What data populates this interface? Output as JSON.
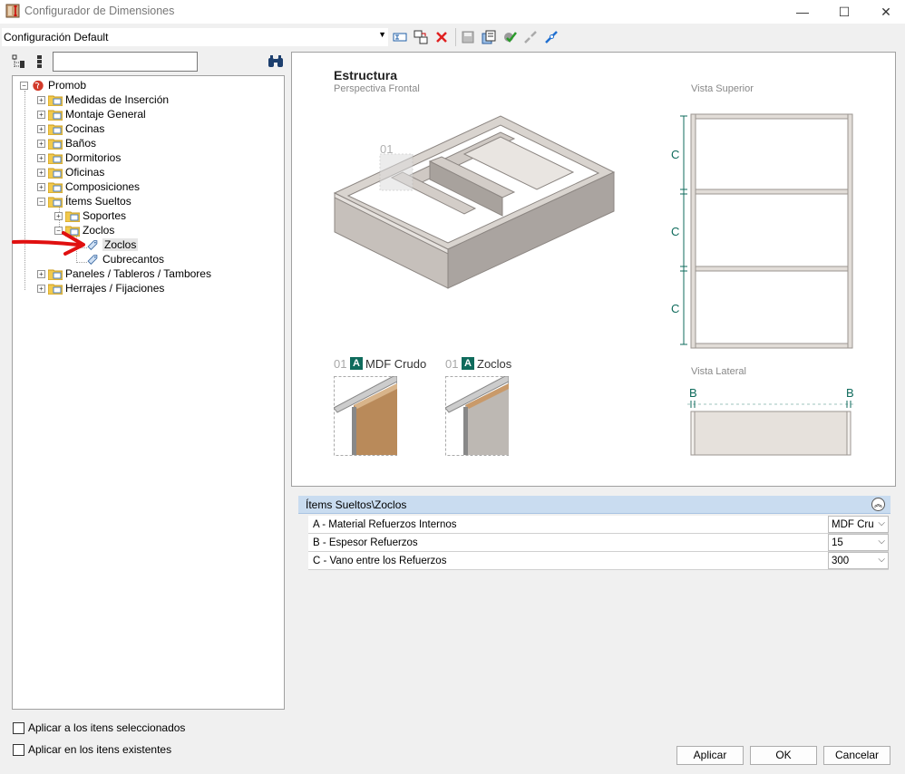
{
  "window": {
    "title": "Configurador de Dimensiones",
    "minimize": "—",
    "maximize": "☐",
    "close": "✕"
  },
  "toolbar": {
    "config_value": "Configuración Default",
    "icons": [
      "dropdown-arrow-icon",
      "rename-icon",
      "copy-config-icon",
      "delete-icon",
      "save-icon",
      "export-icon",
      "apply-check-icon",
      "unlink-icon",
      "link-icon"
    ]
  },
  "search": {
    "value": ""
  },
  "tree": {
    "root": "Promob",
    "items": [
      "Medidas de Inserción",
      "Montaje General",
      "Cocinas",
      "Baños",
      "Dormitorios",
      "Oficinas",
      "Composiciones",
      "Ítems Sueltos",
      "Soportes",
      "Zoclos",
      "Zoclos",
      "Cubrecantos",
      "Paneles / Tableros / Tambores",
      "Herrajes / Fijaciones"
    ]
  },
  "options": {
    "apply_selected": "Aplicar a los itens seleccionados",
    "apply_existing": "Aplicar en los itens existentes"
  },
  "preview": {
    "title": "Estructura",
    "subtitle": "Perspectiva Frontal",
    "top_view": "Vista Superior",
    "side_view": "Vista Lateral",
    "marker_01": "01",
    "dim_c": "C",
    "dim_b": "B",
    "badge_a": "A",
    "swatch1_num": "01",
    "swatch1_label": "MDF Crudo",
    "swatch2_num": "01",
    "swatch2_label": "Zoclos",
    "accent": "#0f6b5c"
  },
  "grid": {
    "header": "Ítems Sueltos\\Zoclos",
    "rows": [
      {
        "label": "A - Material Refuerzos Internos",
        "value": "MDF Crudo"
      },
      {
        "label": "B - Espesor Refuerzos",
        "value": "15"
      },
      {
        "label": "C - Vano entre los Refuerzos",
        "value": "300"
      }
    ]
  },
  "buttons": {
    "apply": "Aplicar",
    "ok": "OK",
    "cancel": "Cancelar"
  }
}
